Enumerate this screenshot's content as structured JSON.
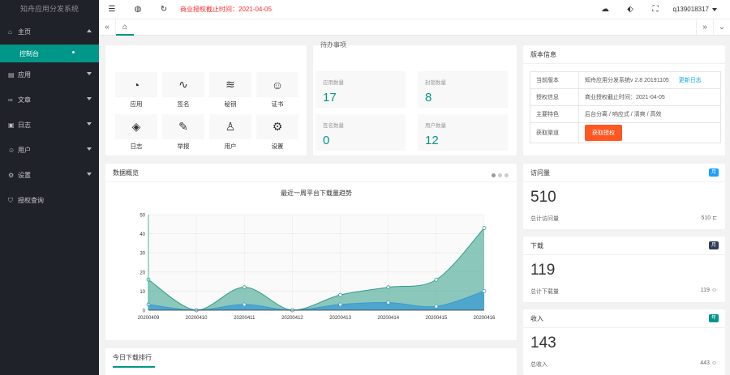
{
  "app": {
    "title": "知舟应用分发系统"
  },
  "nav": {
    "home": "主页",
    "console": "控制台",
    "apps": "应用",
    "articles": "文章",
    "logs": "日志",
    "users": "用户",
    "settings": "设置",
    "auth_query": "授权查询"
  },
  "header": {
    "notice": "商业授权截止时间：2021-04-05",
    "username": "q139018317"
  },
  "shortcuts": [
    {
      "label": "应用",
      "icon": "dashboard-icon"
    },
    {
      "label": "签名",
      "icon": "pulse-icon"
    },
    {
      "label": "秘钥",
      "icon": "layers-icon"
    },
    {
      "label": "证书",
      "icon": "smile-icon"
    },
    {
      "label": "日志",
      "icon": "compass-icon"
    },
    {
      "label": "举报",
      "icon": "report-icon"
    },
    {
      "label": "用户",
      "icon": "user-icon"
    },
    {
      "label": "设置",
      "icon": "gear-icon"
    }
  ],
  "pending": {
    "title": "待办事项",
    "items": [
      {
        "label": "应用数量",
        "value": "17"
      },
      {
        "label": "封锁数量",
        "value": "8"
      },
      {
        "label": "签名数量",
        "value": "0"
      },
      {
        "label": "用户数量",
        "value": "12"
      }
    ]
  },
  "version": {
    "title": "版本信息",
    "rows": [
      {
        "k": "当前版本",
        "v": "知舟应用分发系统v 2.8 20191105",
        "link": "更新日志"
      },
      {
        "k": "授权信息",
        "v": "商业授权截止时间：2021-04-05"
      },
      {
        "k": "主要特色",
        "v": "后台分离 / 响应式 / 清爽 / 高效"
      },
      {
        "k": "获取渠道",
        "btn": "获取授权"
      }
    ]
  },
  "overview": {
    "title": "数据概览"
  },
  "chart_data": {
    "type": "area",
    "title": "最近一周平台下载量趋势",
    "x": [
      "20200409",
      "20200410",
      "20200411",
      "20200412",
      "20200413",
      "20200414",
      "20200415",
      "20200416"
    ],
    "ylim": [
      0,
      50
    ],
    "yticks": [
      0,
      10,
      20,
      30,
      40,
      50
    ],
    "series": [
      {
        "values": [
          16,
          0,
          12,
          0,
          8,
          12,
          16,
          43
        ],
        "color": "#2f9e86"
      },
      {
        "values": [
          3,
          0,
          3,
          0,
          3,
          4,
          2,
          10
        ],
        "color": "#3a9bd2"
      }
    ]
  },
  "stats": [
    {
      "title": "访问量",
      "badge": "月",
      "badge_color": "#1e9fff",
      "value": "510",
      "sub": "总计访问量",
      "subv": "510"
    },
    {
      "title": "下载",
      "badge": "月",
      "badge_color": "#2f4056",
      "value": "119",
      "sub": "总计下载量",
      "subv": "119"
    },
    {
      "title": "收入",
      "badge": "年",
      "badge_color": "#009688",
      "value": "143",
      "sub": "总收入",
      "subv": "443"
    }
  ],
  "ranking": {
    "title": "今日下载排行"
  }
}
